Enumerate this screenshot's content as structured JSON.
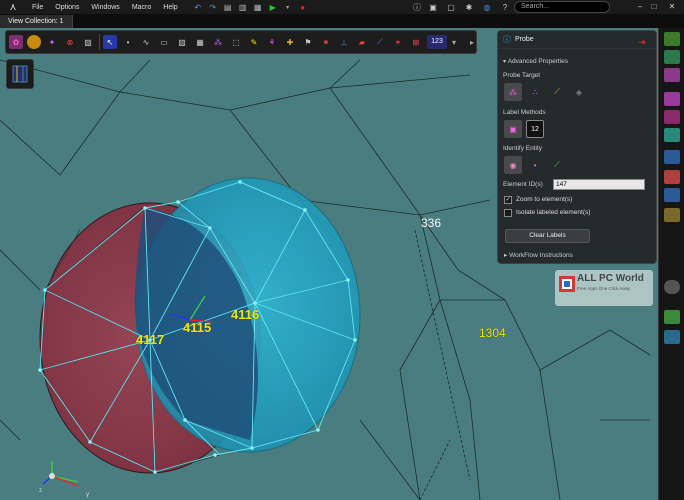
{
  "menubar": {
    "items": [
      "File",
      "Options",
      "Windows",
      "Macro",
      "Help"
    ],
    "search_placeholder": "Search..."
  },
  "tabs": {
    "active": "View Collection: 1"
  },
  "toolbar": {
    "counter_label": "123"
  },
  "probe": {
    "title": "Probe",
    "advanced_properties": "Advanced Properties",
    "probe_target": "Probe Target",
    "label_methods": "Label Methods",
    "label_method_icon_text": "12",
    "identify_entity": "Identify Entity",
    "element_ids_label": "Element ID(s)",
    "element_ids_value": "147",
    "zoom_to_elements": "Zoom to element(s)",
    "zoom_checked": true,
    "isolate_labeled": "Isolate labeled element(s)",
    "isolate_checked": false,
    "clear_labels": "Clear Labels",
    "workflow_instructions": "WorkFlow Instructions"
  },
  "watermark": {
    "title": "ALL PC World",
    "subtitle": "Free Apps One Click Away"
  },
  "labels": {
    "n4117": "4117",
    "n4115": "4115",
    "n4116": "4116",
    "n1304": "1304",
    "n336": "336"
  },
  "colors": {
    "viewport_bg": "#4a7d7f",
    "red_sphere": "#8a3a48",
    "blue_sphere": "#2aa0bf",
    "label_yellow": "#f4e600"
  }
}
